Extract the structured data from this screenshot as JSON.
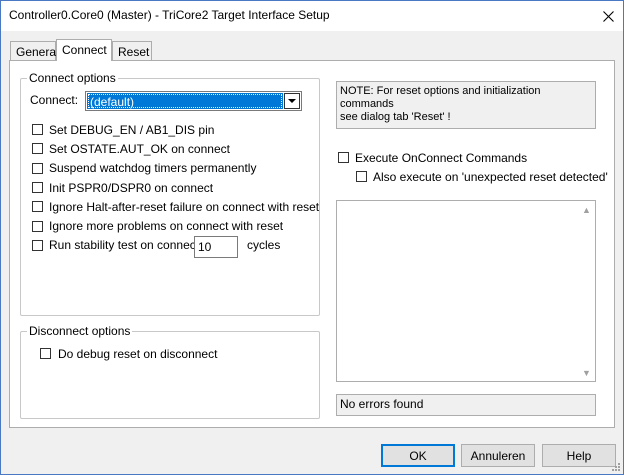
{
  "window": {
    "title": "Controller0.Core0 (Master) - TriCore2 Target Interface Setup"
  },
  "tabs": [
    {
      "label": "General"
    },
    {
      "label": "Connect"
    },
    {
      "label": "Reset"
    }
  ],
  "connect_options": {
    "legend": "Connect options",
    "connect_label": "Connect:",
    "connect_value": "(default)",
    "checkboxes": [
      {
        "label": "Set DEBUG_EN / AB1_DIS pin",
        "checked": false
      },
      {
        "label": "Set OSTATE.AUT_OK on connect",
        "checked": false
      },
      {
        "label": "Suspend watchdog timers permanently",
        "checked": false
      },
      {
        "label": "Init PSPR0/DSPR0 on connect",
        "checked": false
      },
      {
        "label": "Ignore Halt-after-reset failure on connect with reset",
        "checked": false
      },
      {
        "label": "Ignore more problems on connect with reset",
        "checked": false
      },
      {
        "label": "Run stability test on connect",
        "checked": false
      }
    ],
    "cycles_value": "10",
    "cycles_label": "cycles"
  },
  "disconnect_options": {
    "legend": "Disconnect options",
    "checkbox_label": "Do debug reset on disconnect"
  },
  "note": {
    "line1": "NOTE: For reset options and initialization commands",
    "line2": "see dialog tab 'Reset' !"
  },
  "onconnect": {
    "execute_label": "Execute OnConnect Commands",
    "also_label": "Also execute on 'unexpected reset detected'"
  },
  "status": {
    "text": "No errors found"
  },
  "buttons": {
    "ok": "OK",
    "cancel": "Annuleren",
    "help": "Help"
  },
  "colors": {
    "selection": "#0078d7",
    "window_border": "#4a78c2",
    "dialog_bg": "#f0f0f0"
  }
}
